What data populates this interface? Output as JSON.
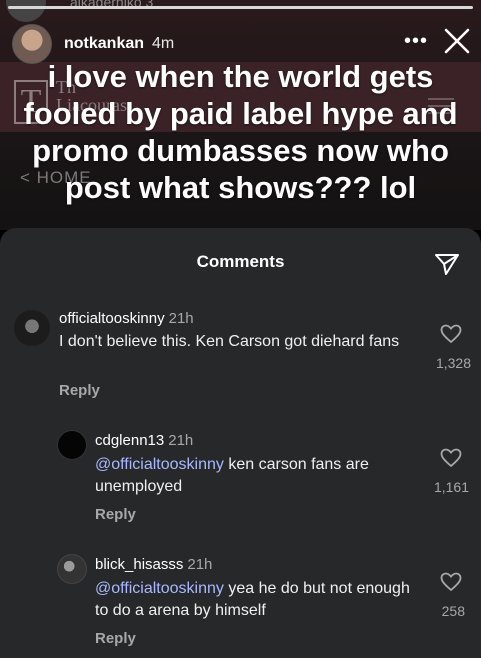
{
  "story": {
    "top_faded_text": "aikaderniko 3",
    "username": "notkankan",
    "time": "4m",
    "more_glyph": "•••",
    "overlay_text": "i love when the world gets fooled by paid label hype and promo dumbasses now who post what shows??? lol",
    "background": {
      "logo_letter": "T",
      "logo_line1": "Th",
      "logo_line2": "Liacouras",
      "home_link": "< HOME"
    }
  },
  "comments_sheet": {
    "title": "Comments",
    "comments": [
      {
        "username": "officialtooskinny",
        "time": "21h",
        "mention": "",
        "text": "I don't believe this. Ken Carson got diehard fans",
        "reply_label": "Reply",
        "likes": "1,328"
      },
      {
        "username": "cdglenn13",
        "time": "21h",
        "mention": "@officialtooskinny",
        "text": " ken carson fans are unemployed",
        "reply_label": "Reply",
        "likes": "1,161"
      },
      {
        "username": "blick_hisasss",
        "time": "21h",
        "mention": "@officialtooskinny",
        "text": " yea he do but not enough to do a arena by himself",
        "reply_label": "Reply",
        "likes": "258"
      }
    ]
  },
  "colors": {
    "mention": "#a9b8ff",
    "sheet_bg": "#272829",
    "secondary_text": "#a8a8a8"
  },
  "icons": [
    "close-icon",
    "more-icon",
    "send-icon",
    "heart-icon"
  ]
}
